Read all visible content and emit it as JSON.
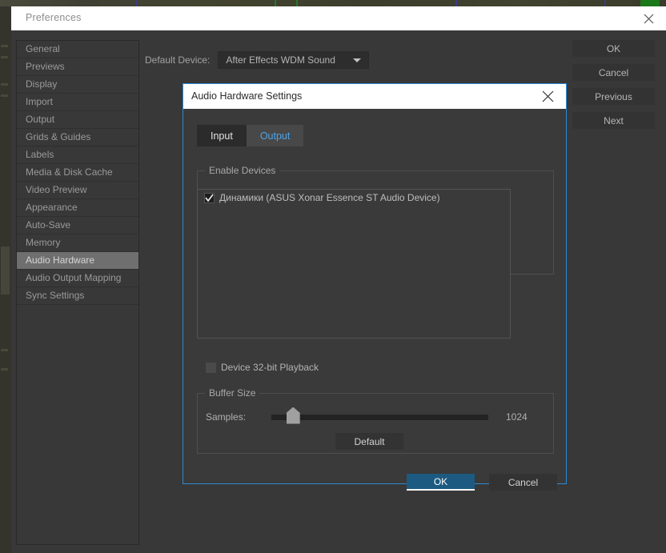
{
  "window": {
    "title": "Preferences",
    "close_icon": "close-icon"
  },
  "sidebar": {
    "items": [
      {
        "label": "General",
        "selected": false
      },
      {
        "label": "Previews",
        "selected": false
      },
      {
        "label": "Display",
        "selected": false
      },
      {
        "label": "Import",
        "selected": false
      },
      {
        "label": "Output",
        "selected": false
      },
      {
        "label": "Grids & Guides",
        "selected": false
      },
      {
        "label": "Labels",
        "selected": false
      },
      {
        "label": "Media & Disk Cache",
        "selected": false
      },
      {
        "label": "Video Preview",
        "selected": false
      },
      {
        "label": "Appearance",
        "selected": false
      },
      {
        "label": "Auto-Save",
        "selected": false
      },
      {
        "label": "Memory",
        "selected": false
      },
      {
        "label": "Audio Hardware",
        "selected": true
      },
      {
        "label": "Audio Output Mapping",
        "selected": false
      },
      {
        "label": "Sync Settings",
        "selected": false
      }
    ]
  },
  "default_device": {
    "label": "Default Device:",
    "value": "After Effects WDM Sound",
    "arrow_icon": "chevron-down-icon"
  },
  "side_buttons": [
    {
      "label": "OK"
    },
    {
      "label": "Cancel"
    },
    {
      "label": "Previous"
    },
    {
      "label": "Next"
    }
  ],
  "dialog": {
    "title": "Audio Hardware Settings",
    "close_icon": "close-icon",
    "tabs": [
      {
        "label": "Input",
        "active": true
      },
      {
        "label": "Output",
        "active": false
      }
    ],
    "enable_devices": {
      "legend": "Enable Devices",
      "items": [
        {
          "label": "Динамики (ASUS Xonar Essence ST Audio Device)",
          "checked": true
        }
      ]
    },
    "playback_option": {
      "label": "Device 32-bit Playback",
      "checked": false
    },
    "buffer_size": {
      "legend": "Buffer Size",
      "samples_label": "Samples:",
      "samples_value": "1024",
      "slider_position_percent": 8,
      "default_button": "Default"
    },
    "actions": [
      {
        "label": "OK",
        "kind": "primary"
      },
      {
        "label": "Cancel",
        "kind": "secondary"
      }
    ]
  },
  "colors": {
    "accent_blue": "#2e8ad4",
    "primary_button": "#1c5a82",
    "tab_link": "#4ba3e8",
    "window_bg": "#383838",
    "selected_item": "#6f6f6f"
  }
}
